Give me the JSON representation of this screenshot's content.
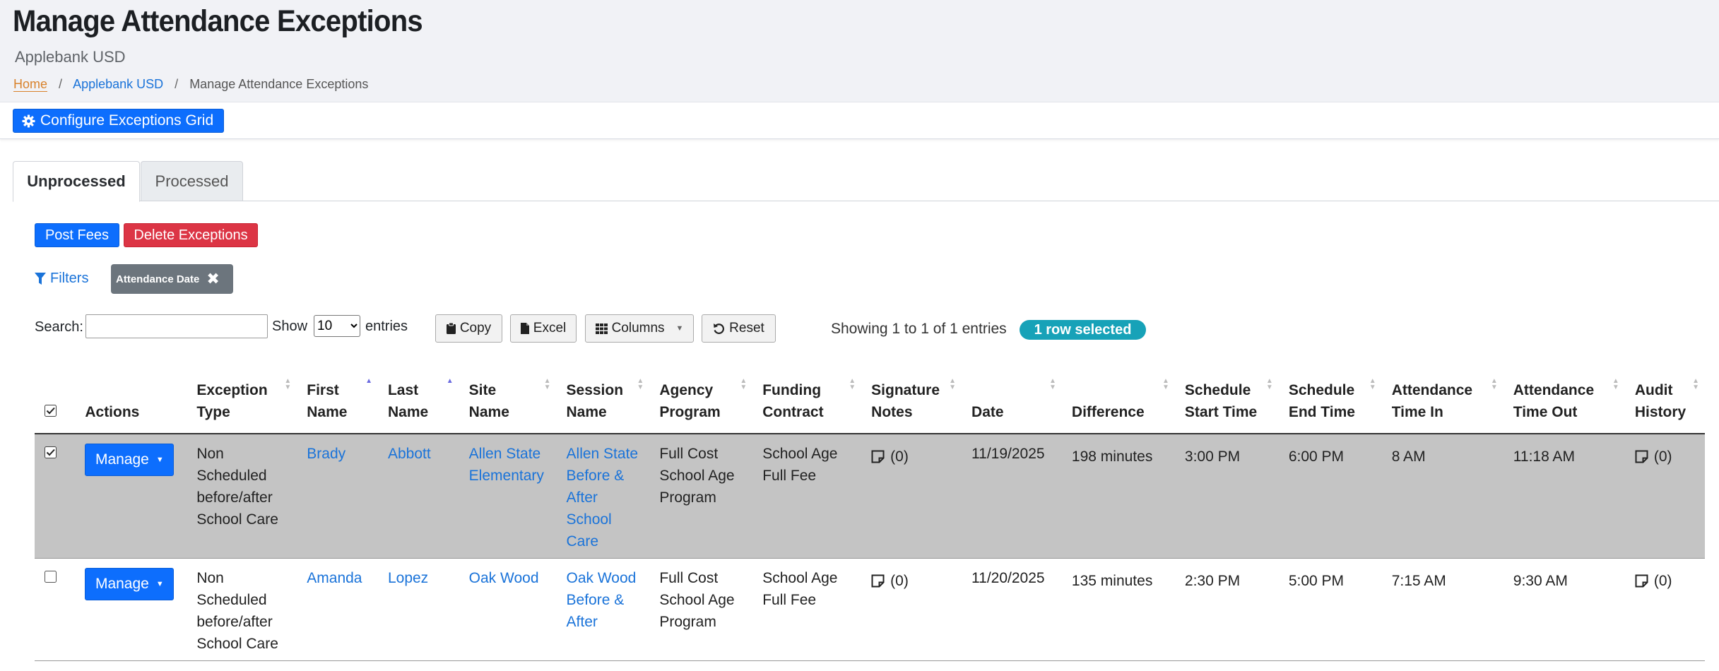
{
  "header": {
    "title": "Manage Attendance Exceptions",
    "subtitle": "Applebank USD",
    "breadcrumb": [
      "Home",
      "Applebank USD",
      "Manage Attendance Exceptions"
    ]
  },
  "toolbar": {
    "configure_label": "Configure Exceptions Grid"
  },
  "tabs": [
    "Unprocessed",
    "Processed"
  ],
  "actions": {
    "post_fees": "Post Fees",
    "delete_exceptions": "Delete Exceptions"
  },
  "filters": {
    "label": "Filters",
    "chip": "Attendance Date"
  },
  "datatable": {
    "search_label": "Search:",
    "search_value": "",
    "show_label": "Show",
    "page_size": "10",
    "entries_label": "entries",
    "copy": "Copy",
    "excel": "Excel",
    "columns": "Columns",
    "reset": "Reset",
    "showing": "Showing 1 to 1 of 1 entries",
    "selected_badge": "1 row selected"
  },
  "table": {
    "headers": {
      "actions": "Actions",
      "exception_type": "Exception Type",
      "first_name": "First Name",
      "last_name": "Last Name",
      "site_name": "Site Name",
      "session_name": "Session Name",
      "agency_program": "Agency Program",
      "funding_contract": "Funding Contract",
      "signature_notes": "Signature Notes",
      "date": "Date",
      "difference": "Difference",
      "schedule_start": "Schedule Start Time",
      "schedule_end": "Schedule End Time",
      "attendance_in": "Attendance Time In",
      "attendance_out": "Attendance Time Out",
      "audit_history": "Audit History"
    },
    "rows": [
      {
        "selected": true,
        "manage": "Manage",
        "exception_type": "Non Scheduled before/after School Care",
        "first_name": "Brady",
        "last_name": "Abbott",
        "site_name": "Allen State Elementary",
        "session_name": "Allen State Before & After School Care",
        "agency_program": "Full Cost School Age Program",
        "funding_contract": "School Age Full Fee",
        "signature_notes": "(0)",
        "date": "11/19/2025",
        "difference": "198 minutes",
        "schedule_start": "3:00 PM",
        "schedule_end": "6:00 PM",
        "attendance_in": "8 AM",
        "attendance_out": "11:18 AM",
        "audit_history": "(0)"
      },
      {
        "selected": false,
        "manage": "Manage",
        "exception_type": "Non Scheduled before/after School Care",
        "first_name": "Amanda",
        "last_name": "Lopez",
        "site_name": "Oak Wood",
        "session_name": "Oak Wood Before & After",
        "agency_program": "Full Cost School Age Program",
        "funding_contract": "School Age Full Fee",
        "signature_notes": "(0)",
        "date": "11/20/2025",
        "difference": "135 minutes",
        "schedule_start": "2:30 PM",
        "schedule_end": "5:00 PM",
        "attendance_in": "7:15 AM",
        "attendance_out": "9:30 AM",
        "audit_history": "(0)"
      }
    ]
  },
  "colors": {
    "primary": "#0d6efd",
    "danger": "#dc3545",
    "link": "#1a73d9",
    "badge": "#17a2b8",
    "chip": "#6c757d",
    "selected_row": "#c4c4c4"
  }
}
